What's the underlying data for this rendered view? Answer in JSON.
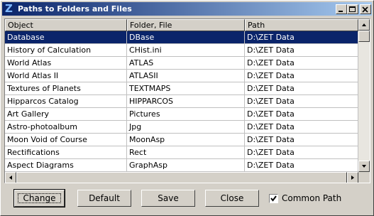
{
  "window": {
    "title": "Paths to Folders and Files",
    "app_icon": "Z",
    "controls": {
      "minimize": "minimize-icon",
      "maximize": "maximize-icon",
      "close": "close-icon"
    }
  },
  "table": {
    "columns": [
      "Object",
      "Folder, File",
      "Path"
    ],
    "selected_index": 0,
    "rows": [
      [
        "Database",
        "DBase",
        "D:\\ZET Data"
      ],
      [
        "History of Calculation",
        "CHist.ini",
        "D:\\ZET Data"
      ],
      [
        "World Atlas",
        "ATLAS",
        "D:\\ZET Data"
      ],
      [
        "World Atlas II",
        "ATLASII",
        "D:\\ZET Data"
      ],
      [
        "Textures of Planets",
        "TEXTMAPS",
        "D:\\ZET Data"
      ],
      [
        "Hipparcos Catalog",
        "HIPPARCOS",
        "D:\\ZET Data"
      ],
      [
        "Art Gallery",
        "Pictures",
        "D:\\ZET Data"
      ],
      [
        "Astro-photoalbum",
        "Jpg",
        "D:\\ZET Data"
      ],
      [
        "Moon Void of Course",
        "MoonAsp",
        "D:\\ZET Data"
      ],
      [
        "Rectifications",
        "Rect",
        "D:\\ZET Data"
      ],
      [
        "Aspect Diagrams",
        "GraphAsp",
        "D:\\ZET Data"
      ]
    ]
  },
  "buttons": {
    "change": "Change",
    "default": "Default",
    "save": "Save",
    "close": "Close"
  },
  "common_path": {
    "label": "Common Path",
    "checked": true
  },
  "colors": {
    "selection": "#0a246a",
    "titlebar_start": "#0a246a",
    "titlebar_end": "#a6caf0",
    "face": "#d4d0c8"
  }
}
